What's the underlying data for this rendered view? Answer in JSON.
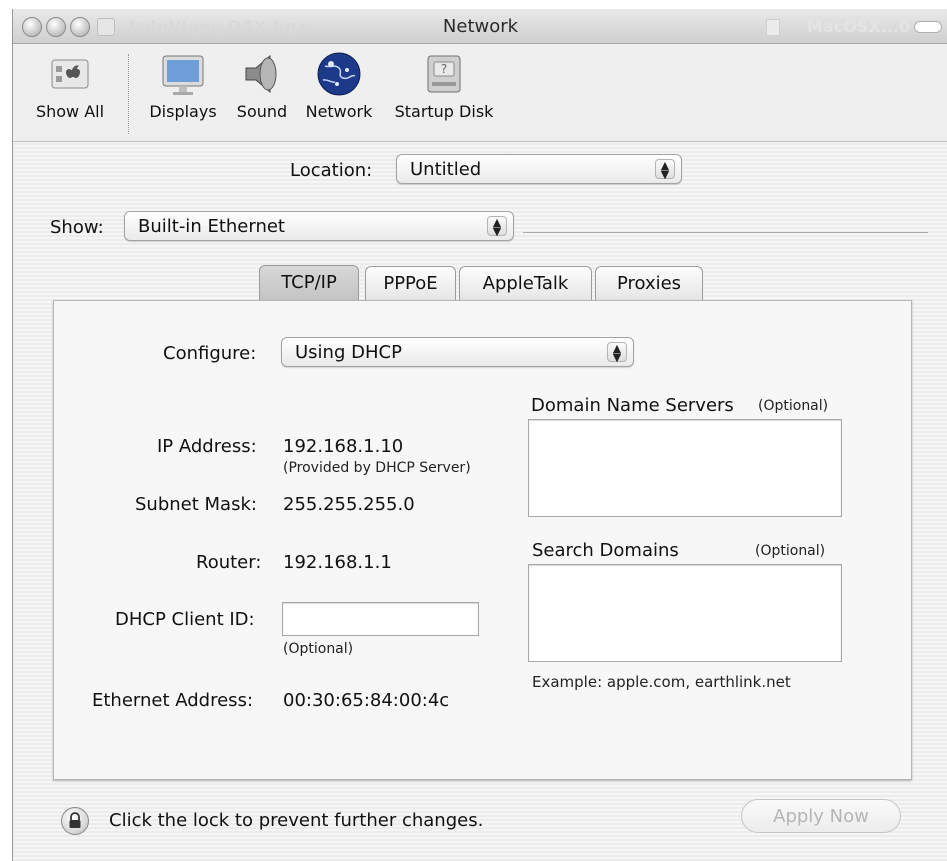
{
  "window": {
    "title": "Network",
    "background_title_left": "isdnVigor_OSX.hqx",
    "background_title_right": "MacOSX...0"
  },
  "toolbar": {
    "items": [
      {
        "label": "Show All",
        "icon": "show-all-icon"
      },
      {
        "label": "Displays",
        "icon": "displays-icon"
      },
      {
        "label": "Sound",
        "icon": "sound-icon"
      },
      {
        "label": "Network",
        "icon": "network-globe-icon"
      },
      {
        "label": "Startup Disk",
        "icon": "startup-disk-icon"
      }
    ]
  },
  "location": {
    "label": "Location:",
    "value": "Untitled"
  },
  "show": {
    "label": "Show:",
    "value": "Built-in Ethernet"
  },
  "tabs": [
    {
      "label": "TCP/IP",
      "selected": true
    },
    {
      "label": "PPPoE",
      "selected": false
    },
    {
      "label": "AppleTalk",
      "selected": false
    },
    {
      "label": "Proxies",
      "selected": false
    }
  ],
  "tcpip": {
    "configure": {
      "label": "Configure:",
      "value": "Using DHCP"
    },
    "ip_address": {
      "label": "IP Address:",
      "value": "192.168.1.10",
      "note": "(Provided by DHCP Server)"
    },
    "subnet_mask": {
      "label": "Subnet Mask:",
      "value": "255.255.255.0"
    },
    "router": {
      "label": "Router:",
      "value": "192.168.1.1"
    },
    "dhcp_client_id": {
      "label": "DHCP Client ID:",
      "value": "",
      "note": "(Optional)"
    },
    "ethernet_address": {
      "label": "Ethernet Address:",
      "value": "00:30:65:84:00:4c"
    },
    "dns": {
      "label": "Domain Name Servers",
      "optional": "(Optional)",
      "value": ""
    },
    "search_domains": {
      "label": "Search Domains",
      "optional": "(Optional)",
      "value": "",
      "example": "Example: apple.com, earthlink.net"
    }
  },
  "footer": {
    "lock_text": "Click the lock to prevent further changes.",
    "apply_label": "Apply Now"
  }
}
